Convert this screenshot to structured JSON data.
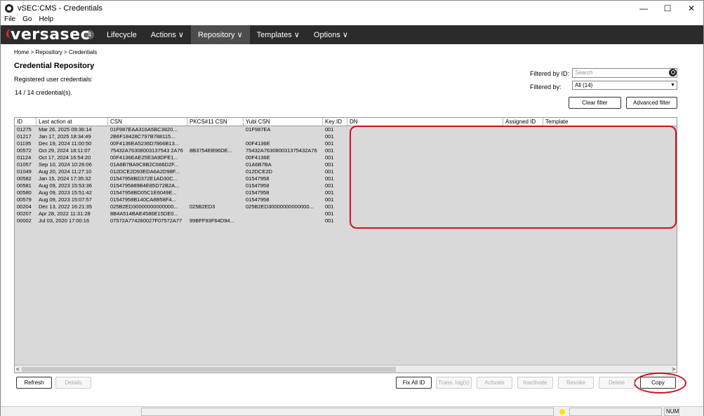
{
  "window": {
    "title": "vSEC:CMS -  Credentials",
    "minimize": "—",
    "maximize": "☐",
    "close": "✕"
  },
  "menu": [
    "File",
    "Go",
    "Help"
  ],
  "nav": {
    "logo": "versasec",
    "badge": "4",
    "items": [
      "Lifecycle",
      "Actions ∨",
      "Repository ∨",
      "Templates ∨",
      "Options ∨"
    ]
  },
  "breadcrumb": "Home > Repository > Credentials",
  "page_title": "Credential Repository",
  "subtitle": "Registered user credentials:",
  "count": "14 / 14 credential(s).",
  "filter": {
    "id_label": "Filtered by ID:",
    "search_placeholder": "Search",
    "by_label": "Filtered by:",
    "by_value": "All (14)",
    "clear_btn": "Clear filter",
    "advanced_btn": "Advanced filter"
  },
  "table": {
    "columns": [
      "ID",
      "Last action at",
      "CSN",
      "PKCS#11 CSN",
      "Yubi CSN",
      "Key ID",
      "DN",
      "Assigned ID",
      "Template"
    ],
    "rows": [
      [
        "01275",
        "Mar 26, 2025 09:36:14",
        "01F987EAA316A5BC3820...",
        "",
        "01F987EA",
        "001"
      ],
      [
        "01217",
        "Jan 17, 2025 18:34:49",
        "2B6F18428C797B788115...",
        "",
        "",
        "001"
      ],
      [
        "01195",
        "Dec 19, 2024 11:00:50",
        "00F4136EA5236D7866B13...",
        "",
        "00F4136E",
        "001"
      ],
      [
        "00572",
        "Oct 29, 2024 18:11:07",
        "75432A76308003137543 2A76",
        "8B3754EB96DE...",
        "75432A763080031375432A76",
        "001"
      ],
      [
        "01124",
        "Oct 17, 2024 16:54:20",
        "00F4136EAE25E3A9DFE1...",
        "",
        "00F4136E",
        "001"
      ],
      [
        "01057",
        "Sep 10, 2024 10:26:06",
        "01A6B7BA9C8B2C666D2F...",
        "",
        "01A6B7BA",
        "001"
      ],
      [
        "01049",
        "Aug 20, 2024 11:27:10",
        "012DCE2D93EDA6A2D98F...",
        "",
        "012DCE2D",
        "001"
      ],
      [
        "00582",
        "Jan 15, 2024 17:35:32",
        "01547958BD372E1AD30C...",
        "",
        "01547958",
        "001"
      ],
      [
        "00581",
        "Aug 09, 2023 15:53:36",
        "0154795889B4E85D72B2A...",
        "",
        "01547958",
        "001"
      ],
      [
        "00580",
        "Aug 09, 2023 15:51:42",
        "01547958BD05C1E6049E...",
        "",
        "01547958",
        "001"
      ],
      [
        "00579",
        "Aug 09, 2023 15:07:57",
        "01547958B140CA8B58F4...",
        "",
        "01547958",
        "001"
      ],
      [
        "00204",
        "Dec 13, 2022 16:21:35",
        "025B2ED30000000000000...",
        "025B2ED3",
        "025B2ED30000000000000...",
        "001"
      ],
      [
        "00207",
        "Apr 28, 2022 11:31:28",
        "8B4A514BAE4586E15DE0...",
        "",
        "",
        "001"
      ],
      [
        "00002",
        "Jul 03, 2020 17:00:16",
        "07572A774280027F07572A77",
        "99BFF93F64D94...",
        "",
        "001"
      ]
    ]
  },
  "scroll": {
    "left": "<",
    "right": ">"
  },
  "buttons": {
    "refresh": "Refresh",
    "details": "Details",
    "fix_all_id": "Fix All ID",
    "trans_log": "Trans. log(s)",
    "activate": "Activate",
    "inactivate": "Inactivate",
    "revoke": "Revoke",
    "delete": "Delete",
    "copy": "Copy"
  },
  "status": {
    "num": "NUM"
  },
  "colors": {
    "nav_bg": "#2b2b2b",
    "nav_active": "#4d4d4d",
    "annotation": "#d01020",
    "grid_bg": "#d9d9d9"
  }
}
